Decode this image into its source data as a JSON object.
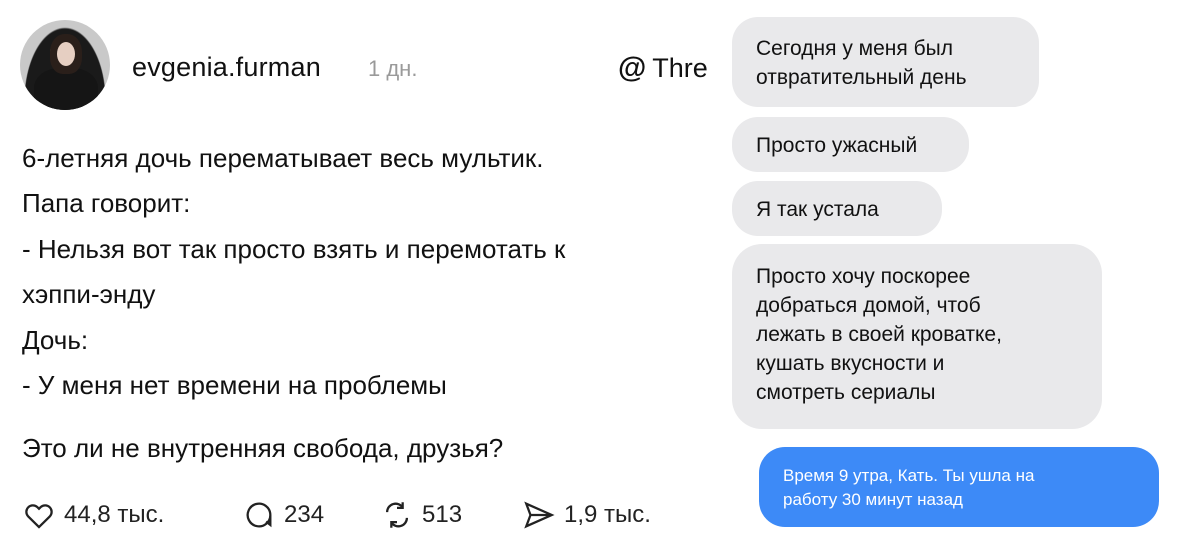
{
  "post": {
    "username": "evgenia.furman",
    "time": "1 дн.",
    "platform": "Thre",
    "lines": [
      "6-летняя дочь перематывает весь мультик.",
      "Папа говорит:",
      "- Нельзя вот так просто взять и перемотать к",
      "хэппи-энду",
      "Дочь:",
      "- У меня нет времени на проблемы",
      "Это ли не внутренняя свобода, друзья?"
    ],
    "actions": {
      "likes": "44,8 тыс.",
      "comments": "234",
      "reposts": "513",
      "shares": "1,9 тыс."
    }
  },
  "chat": {
    "incoming": [
      [
        "Сегодня у меня был",
        "отвратительный день"
      ],
      [
        "Просто ужасный"
      ],
      [
        "Я так устала"
      ],
      [
        "Просто хочу поскорее",
        "добраться домой, чтоб",
        "лежать в своей кроватке,",
        "кушать вкусности и",
        "смотреть сериалы"
      ]
    ],
    "outgoing": [
      "Время 9 утра, Кать. Ты ушла на",
      "работу 30 минут назад"
    ]
  },
  "colors": {
    "bubble_in": "#e9e9eb",
    "bubble_out": "#3d8af7",
    "muted": "#9a9a9a"
  }
}
